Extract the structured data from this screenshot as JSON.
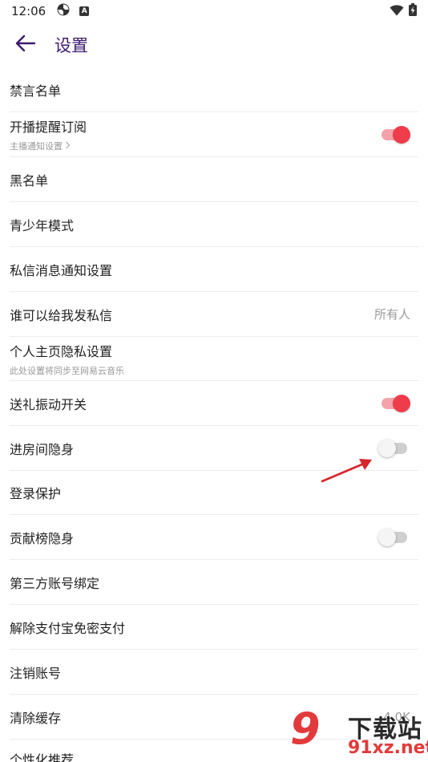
{
  "status_bar": {
    "time": "12:06",
    "left_icons": [
      "pinwheel-icon",
      "a-badge-icon"
    ],
    "a_badge_text": "A",
    "right_icons": [
      "wifi-icon",
      "battery-charging-icon"
    ]
  },
  "header": {
    "title": "设置",
    "back_icon": "arrow-left-icon",
    "title_color": "#3d1a6e"
  },
  "settings": {
    "items": [
      {
        "label": "禁言名单"
      },
      {
        "label": "开播提醒订阅",
        "sub": "主播通知设置",
        "toggle": true
      },
      {
        "label": "黑名单"
      },
      {
        "label": "青少年模式"
      },
      {
        "label": "私信消息通知设置"
      },
      {
        "label": "谁可以给我发私信",
        "value": "所有人"
      },
      {
        "label": "个人主页隐私设置",
        "sub": "此处设置将同步至网易云音乐"
      },
      {
        "label": "送礼振动开关",
        "toggle": true
      },
      {
        "label": "进房间隐身",
        "toggle": false
      },
      {
        "label": "登录保护"
      },
      {
        "label": "贡献榜隐身",
        "toggle": false
      },
      {
        "label": "第三方账号绑定"
      },
      {
        "label": "解除支付宝免密支付"
      },
      {
        "label": "注销账号"
      },
      {
        "label": "清除缓存",
        "value": "4.0K"
      },
      {
        "label": "个性化推荐"
      }
    ]
  },
  "colors": {
    "toggle_on_knob": "#ee3c4b",
    "toggle_on_track": "#f5a3ab",
    "toggle_off_track": "#cfcfcf",
    "annotation_arrow": "#d6262b"
  },
  "watermark": {
    "logo": "9",
    "title": "下载站",
    "url": "91xz.net"
  }
}
